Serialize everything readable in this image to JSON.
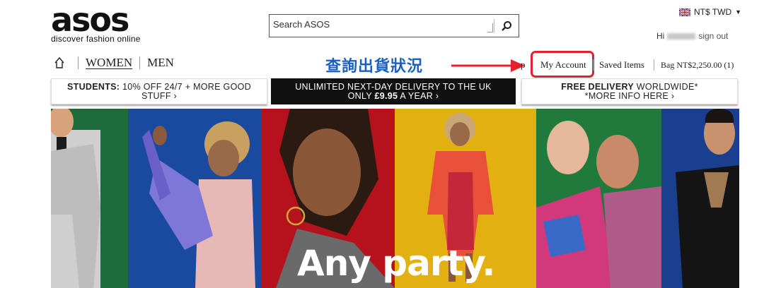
{
  "logo": {
    "wordmark": "asos",
    "tagline": "discover fashion online"
  },
  "search": {
    "placeholder": "Search ASOS",
    "icon": "search-icon"
  },
  "currency": {
    "label": "NT$ TWD"
  },
  "account_bar": {
    "greeting": "Hi",
    "signout": "sign out"
  },
  "nav": {
    "women": "WOMEN",
    "men": "MEN"
  },
  "annotation": {
    "text": "查詢出貨狀況",
    "color": "#1a5fc4",
    "highlight_color": "#e2212b"
  },
  "header_links": {
    "help": "p",
    "my_account": "My Account",
    "saved_items": "Saved Items",
    "bag": "Bag NT$2,250.00 (1)"
  },
  "promos": {
    "students": {
      "bold": "STUDENTS:",
      "text": " 10% OFF 24/7 + MORE GOOD STUFF ›"
    },
    "delivery": {
      "line1": "UNLIMITED NEXT-DAY DELIVERY TO THE UK",
      "line2_prefix": "ONLY ",
      "line2_bold": "£9.95",
      "line2_suffix": " A YEAR ›"
    },
    "worldwide": {
      "bold": "FREE DELIVERY",
      "text": " WORLDWIDE*",
      "line2": "*MORE INFO HERE ›"
    }
  },
  "hero": {
    "headline": "Any party."
  },
  "colors": {
    "black_banner": "#111111",
    "hero_panels": [
      "#1d6b3a",
      "#1a4aa0",
      "#b5121b",
      "#e3b012",
      "#1f7a3b",
      "#1b3f8f"
    ]
  }
}
